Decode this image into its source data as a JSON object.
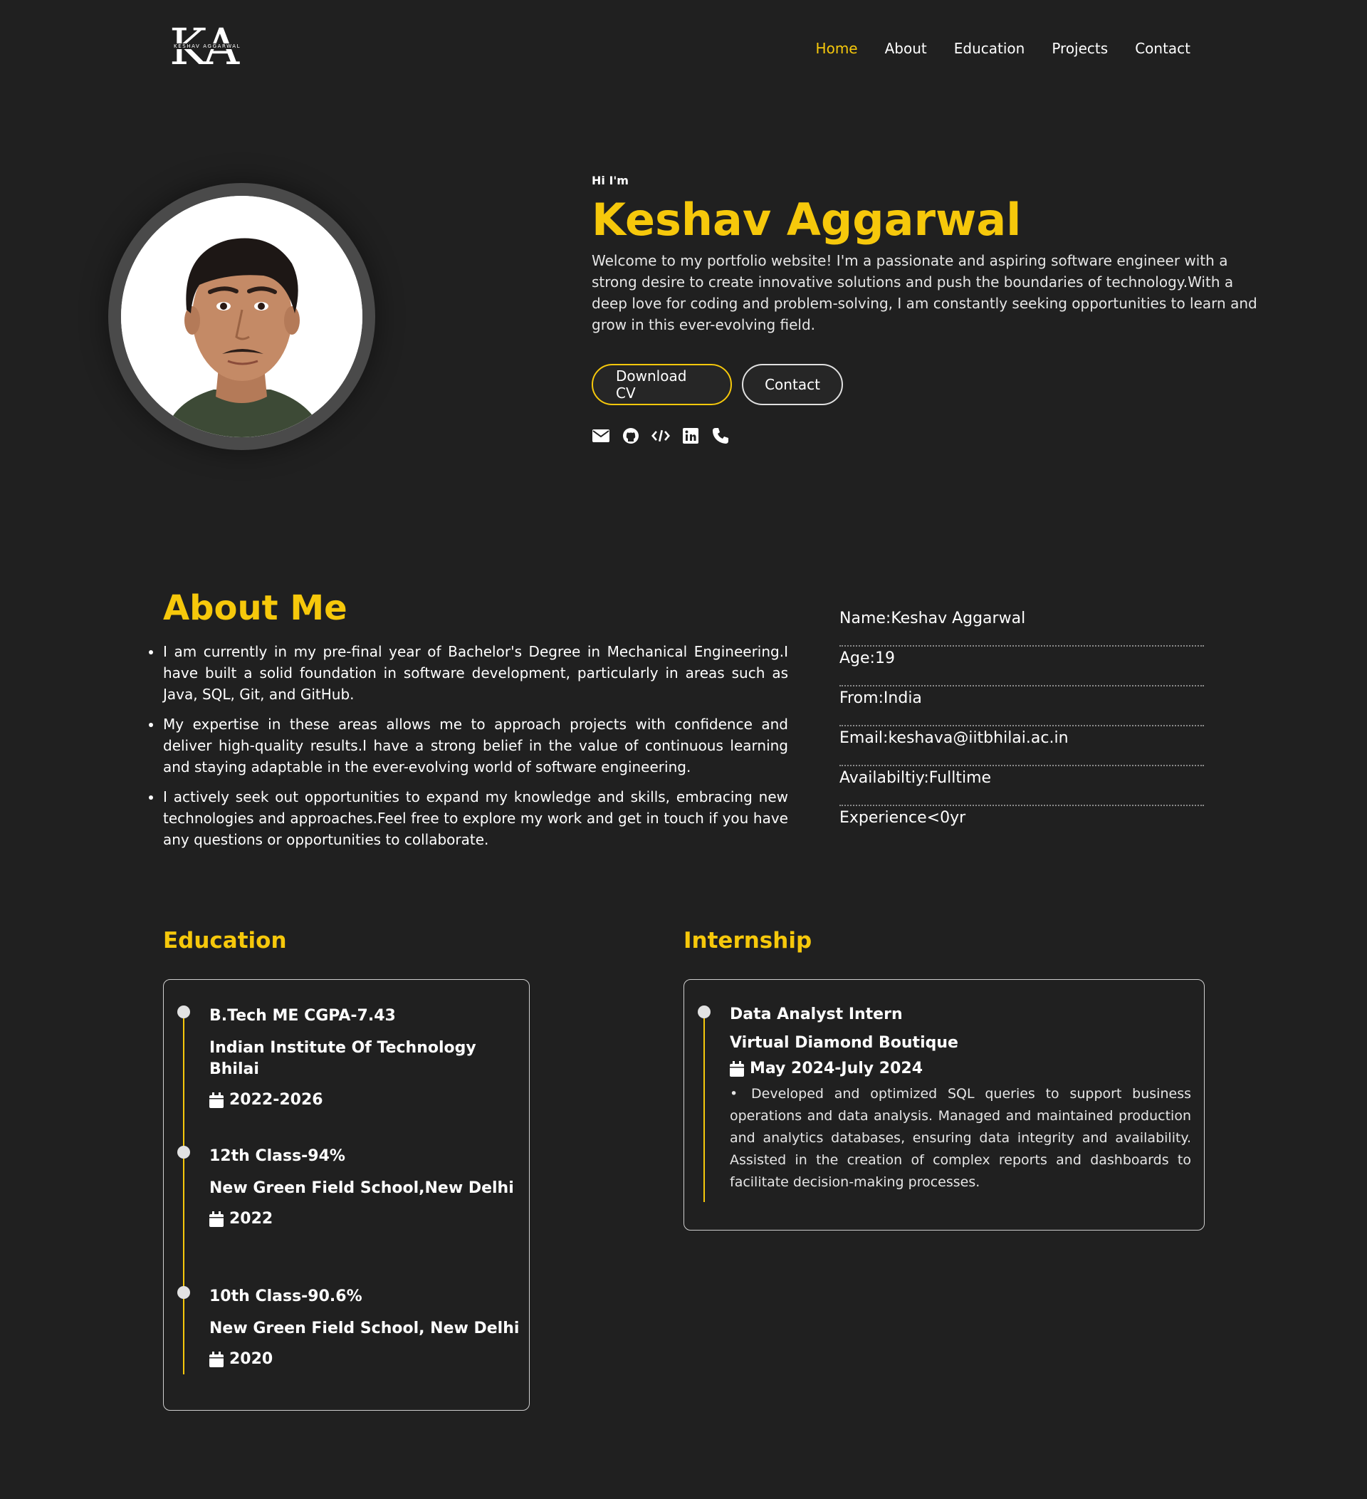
{
  "brand": {
    "logo_letters": "KA",
    "logo_subtitle": "KESHAV AGGARWAL"
  },
  "nav": {
    "items": [
      "Home",
      "About",
      "Education",
      "Projects",
      "Contact"
    ],
    "active": "Home"
  },
  "hero": {
    "greeting": "Hi I'm",
    "name": "Keshav Aggarwal",
    "intro": "Welcome to my portfolio website! I'm a passionate and aspiring software engineer with a strong desire to create innovative solutions and push the boundaries of technology.With a deep love for coding and problem-solving, I am constantly seeking opportunities to learn and grow in this ever-evolving field.",
    "download_button": "Download CV",
    "contact_button": "Contact",
    "social_icons": [
      "envelope-icon",
      "github-icon",
      "code-icon",
      "linkedin-icon",
      "phone-icon"
    ]
  },
  "about": {
    "title": "About Me",
    "points": [
      "I am currently in my pre-final year of Bachelor's Degree in Mechanical Engineering.I have built a solid foundation in software development, particularly in areas such as Java, SQL, Git, and GitHub.",
      "My expertise in these areas allows me to approach projects with confidence and deliver high-quality results.I have a strong belief in the value of continuous learning and staying adaptable in the ever-evolving world of software engineering.",
      "I actively seek out opportunities to expand my knowledge and skills, embracing new technologies and approaches.Feel free to explore my work and get in touch if you have any questions or opportunities to collaborate."
    ],
    "info": [
      "Name:Keshav Aggarwal",
      "Age:19",
      "From:India",
      "Email:keshava@iitbhilai.ac.in",
      "Availabiltiy:Fulltime",
      "Experience<0yr"
    ]
  },
  "education": {
    "title": "Education",
    "entries": [
      {
        "degree": "B.Tech ME CGPA-7.43",
        "school": "Indian Institute Of Technology Bhilai",
        "years": "2022-2026"
      },
      {
        "degree": "12th Class-94%",
        "school": "New Green Field School,New Delhi",
        "years": "2022"
      },
      {
        "degree": "10th Class-90.6%",
        "school": "New Green Field School, New Delhi",
        "years": "2020"
      }
    ]
  },
  "internship": {
    "title": "Internship",
    "role": "Data Analyst Intern",
    "company": "Virtual Diamond Boutique",
    "dates": "May 2024-July 2024",
    "description": "Developed and optimized SQL queries to support business operations and data analysis. Managed and maintained production and analytics databases, ensuring data integrity and availability. Assisted in the creation of complex reports and dashboards to facilitate decision-making processes."
  },
  "colors": {
    "background": "#202020",
    "accent": "#f6c80b",
    "text": "#ffffff"
  }
}
